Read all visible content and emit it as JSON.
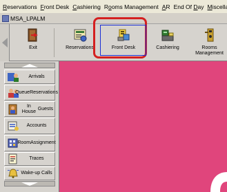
{
  "menubar": {
    "items": [
      {
        "underline": "R",
        "rest": "eservations"
      },
      {
        "underline": "F",
        "rest": "ront Desk"
      },
      {
        "underline": "C",
        "rest": "ashiering"
      },
      {
        "pre": "R",
        "underline": "o",
        "rest": "oms Management"
      },
      {
        "underline": "A",
        "rest": "R"
      },
      {
        "pre": "End Of ",
        "underline": "D",
        "rest": "ay"
      },
      {
        "underline": "M",
        "rest": "iscellaneous"
      }
    ]
  },
  "window": {
    "title": "MSA_LPALM"
  },
  "toolbar": {
    "exit": "Exit",
    "reservations": "Reservations",
    "front_desk": "Front Desk",
    "cashiering": "Cashiering",
    "rooms_management_line1": "Rooms",
    "rooms_management_line2": "Management"
  },
  "sidebar": {
    "arrivals": "Arrivals",
    "queue_line1": "Queue",
    "queue_line2": "Reservations",
    "inhouse_line1": "In House",
    "inhouse_line2": "Guests",
    "accounts": "Accounts",
    "room_line1": "Room",
    "room_line2": "Assignment",
    "traces": "Traces",
    "wakeup": "Wake-up Calls"
  },
  "colors": {
    "main_background": "#e0457c",
    "highlight_frame": "#d42020",
    "focus_border": "#1a2ed6"
  }
}
